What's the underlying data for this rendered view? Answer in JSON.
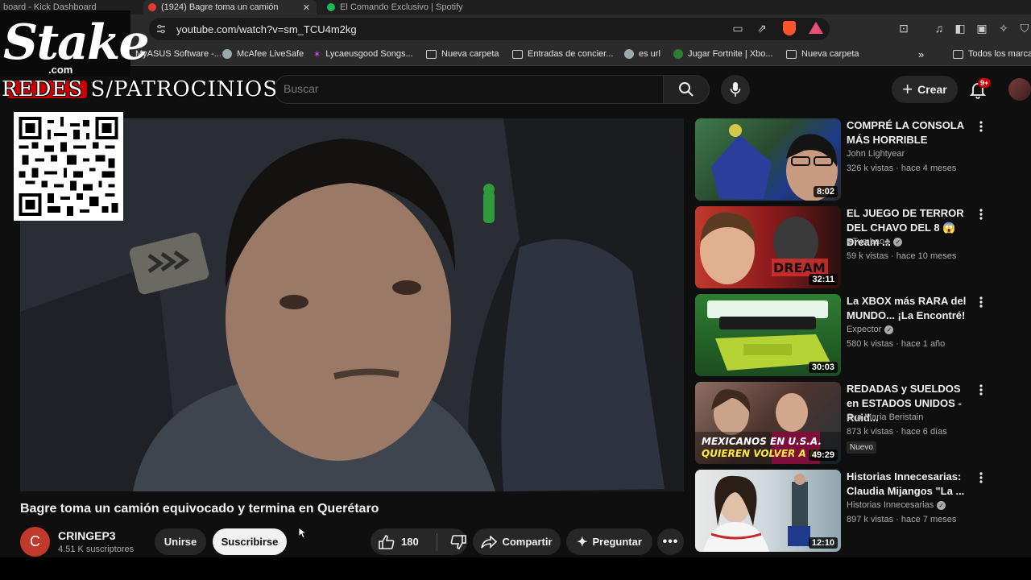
{
  "browser": {
    "tabs": [
      {
        "label": "board - Kick Dashboard",
        "active": false
      },
      {
        "label": "(1924) Bagre toma un camión",
        "active": true
      },
      {
        "label": "El Comando Exclusivo | Spotify",
        "active": false
      }
    ],
    "url": "youtube.com/watch?v=sm_TCU4m2kg",
    "bookmarks": [
      {
        "label": "MyASUS Software -..."
      },
      {
        "label": "McAfee LiveSafe"
      },
      {
        "label": "Lycaeusgood Songs..."
      },
      {
        "label": "Nueva carpeta"
      },
      {
        "label": "Entradas de concier..."
      },
      {
        "label": "es url"
      },
      {
        "label": "Jugar Fortnite | Xbo..."
      },
      {
        "label": "Nueva carpeta"
      },
      {
        "label": "Todos los marca"
      }
    ]
  },
  "overlay": {
    "logo": "Stake",
    "logo_suffix": ".com",
    "banner": "REDES S/PATROCINIOS"
  },
  "header": {
    "search_placeholder": "Buscar",
    "create_label": "Crear",
    "notifications_badge": "9+"
  },
  "video": {
    "title": "Bagre toma un camión equivocado y termina en Querétaro",
    "channel": {
      "initial": "C",
      "name": "CRINGEP3",
      "subscribers": "4.51 K suscriptores"
    },
    "join_label": "Unirse",
    "subscribe_label": "Suscribirse",
    "likes": "180",
    "share_label": "Compartir",
    "ask_label": "Preguntar"
  },
  "recommendations": [
    {
      "title": "COMPRÉ LA CONSOLA MÁS HORRIBLE",
      "channel": "John Lightyear",
      "verified": false,
      "meta": "326 k vistas · hace 4 meses",
      "duration": "8:02",
      "badge": ""
    },
    {
      "title": "EL JUEGO DE TERROR DEL CHAVO DEL 8 😱 Dream ...",
      "channel": "♣Tumbao♣",
      "verified": true,
      "meta": "59 k vistas · hace 10 meses",
      "duration": "32:11",
      "badge": ""
    },
    {
      "title": "La XBOX más RARA del MUNDO... ¡La Encontré!",
      "channel": "Expector",
      "verified": true,
      "meta": "580 k vistas · hace 1 año",
      "duration": "30:03",
      "badge": ""
    },
    {
      "title": "REDADAS y SUELDOS en ESTADOS UNIDOS - Ruid...",
      "channel": "Eva Maria Beristain",
      "verified": false,
      "meta": "873 k vistas · hace 6 días",
      "duration": "49:29",
      "badge": "Nuevo"
    },
    {
      "title": "Historias Innecesarias: Claudia Mijangos \"La ...",
      "channel": "Historias Innecesarias",
      "verified": true,
      "meta": "897 k vistas · hace 7 meses",
      "duration": "12:10",
      "badge": ""
    }
  ],
  "colors": {
    "background": "#0f0f0f",
    "accent_red": "#cc0000",
    "chip_bg": "#272727"
  }
}
